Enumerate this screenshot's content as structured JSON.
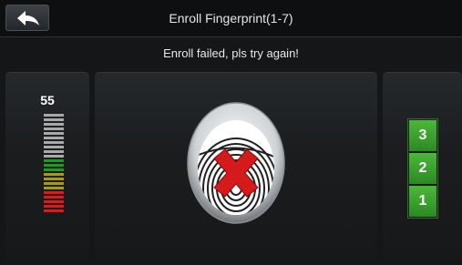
{
  "header": {
    "title": "Enroll Fingerprint(1-7)",
    "back_icon": "back-arrow-icon"
  },
  "message": "Enroll failed, pls try again!",
  "quality": {
    "value": "55",
    "levels": [
      {
        "color": "#a9a9a9",
        "count": 10
      },
      {
        "color": "#1e9a1e",
        "count": 3
      },
      {
        "color": "#a89a14",
        "count": 4
      },
      {
        "color": "#e01818",
        "count": 5
      }
    ]
  },
  "fingerprint": {
    "icon": "fingerprint-icon",
    "status_icon": "red-x-icon"
  },
  "steps": {
    "items": [
      "3",
      "2",
      "1"
    ],
    "color": "#3ea530"
  }
}
